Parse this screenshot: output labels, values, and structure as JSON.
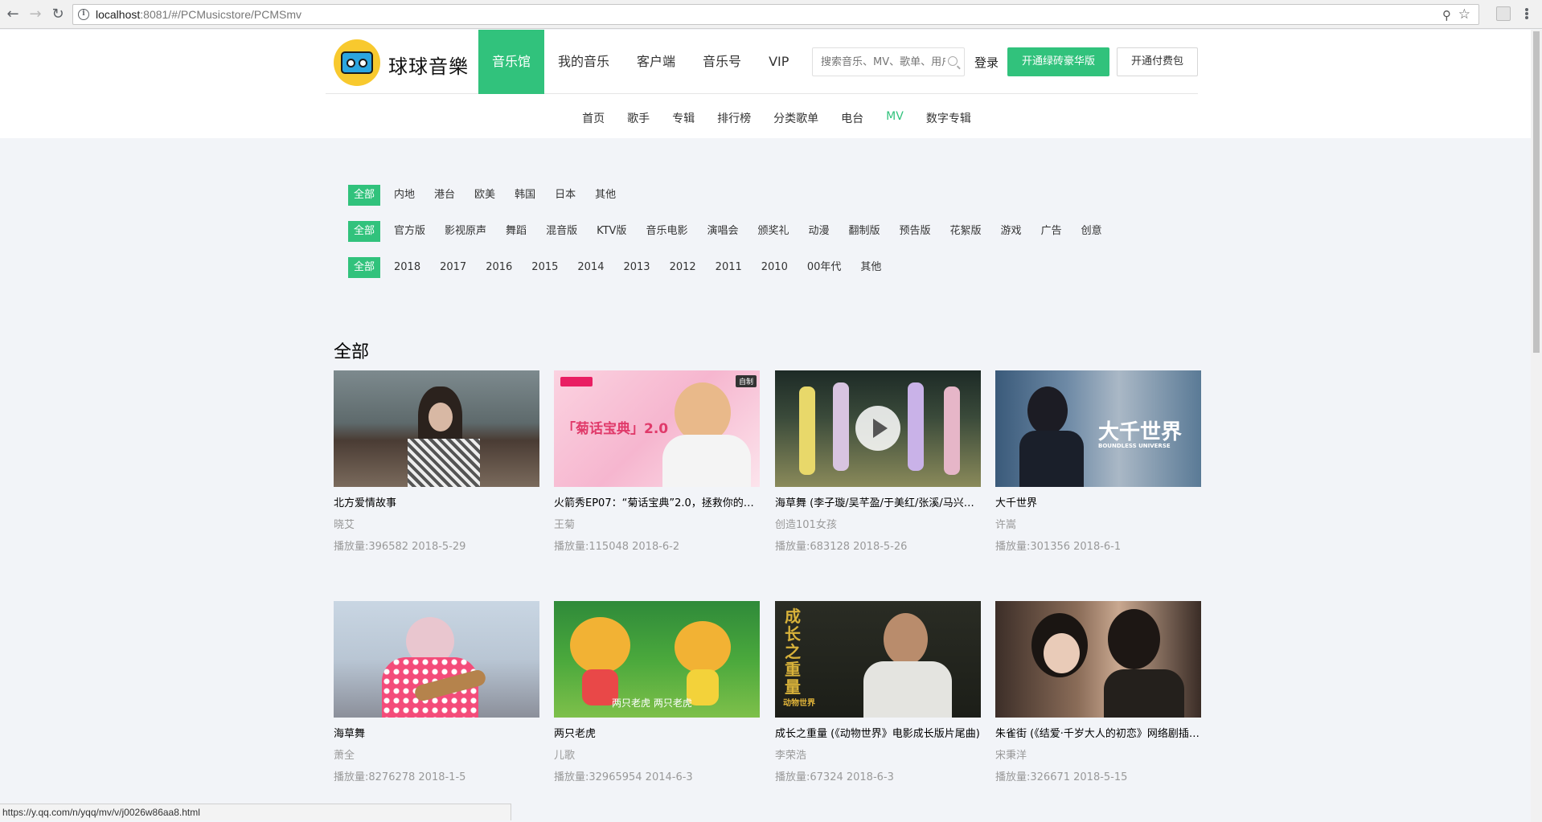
{
  "browser": {
    "url_host": "localhost",
    "url_rest": ":8081/#/PCMusicstore/PCMSmv",
    "status_url": "https://y.qq.com/n/yqq/mv/v/j0026w86aa8.html"
  },
  "header": {
    "brand": "球球音樂",
    "nav": [
      "音乐馆",
      "我的音乐",
      "客户端",
      "音乐号",
      "VIP"
    ],
    "active_nav": "音乐馆",
    "search_placeholder": "搜索音乐、MV、歌单、用户",
    "login": "登录",
    "green_button": "开通绿砖豪华版",
    "outline_button": "开通付费包",
    "sub_nav": [
      "首页",
      "歌手",
      "专辑",
      "排行榜",
      "分类歌单",
      "电台",
      "MV",
      "数字专辑"
    ],
    "active_sub_nav": "MV"
  },
  "filters": {
    "area": [
      "全部",
      "内地",
      "港台",
      "欧美",
      "韩国",
      "日本",
      "其他"
    ],
    "version": [
      "全部",
      "官方版",
      "影视原声",
      "舞蹈",
      "混音版",
      "KTV版",
      "音乐电影",
      "演唱会",
      "颁奖礼",
      "动漫",
      "翻制版",
      "预告版",
      "花絮版",
      "游戏",
      "广告",
      "创意"
    ],
    "year": [
      "全部",
      "2018",
      "2017",
      "2016",
      "2015",
      "2014",
      "2013",
      "2012",
      "2011",
      "2010",
      "00年代",
      "其他"
    ]
  },
  "section_title": "全部",
  "mvs": [
    {
      "title": "北方爱情故事",
      "artist": "晓艾",
      "stats": "播放量:396582 2018-5-29",
      "overlay": ""
    },
    {
      "title": "火箭秀EP07：“菊话宝典”2.0，拯救你的…",
      "artist": "王菊",
      "stats": "播放量:115048 2018-6-2",
      "overlay": "「菊话宝典」2.0",
      "badge": "自制"
    },
    {
      "title": "海草舞 (李子璇/吴芊盈/于美红/张溪/马兴钰…",
      "artist": "创造101女孩",
      "stats": "播放量:683128 2018-5-26",
      "overlay": ""
    },
    {
      "title": "大千世界",
      "artist": "许嵩",
      "stats": "播放量:301356 2018-6-1",
      "overlay": "大千世界",
      "overlay_sub": "BOUNDLESS UNIVERSE"
    },
    {
      "title": "海草舞",
      "artist": "萧全",
      "stats": "播放量:8276278 2018-1-5",
      "overlay": ""
    },
    {
      "title": "两只老虎",
      "artist": "儿歌",
      "stats": "播放量:32965954 2014-6-3",
      "overlay": "两只老虎 两只老虎"
    },
    {
      "title": "成长之重量 (《动物世界》电影成长版片尾曲)",
      "artist": "李荣浩",
      "stats": "播放量:67324 2018-6-3",
      "overlay": "成长之重量",
      "overlay_sub": "动物世界"
    },
    {
      "title": "朱雀街 (《结爱·千岁大人的初恋》网络剧插曲)",
      "artist": "宋秉洋",
      "stats": "播放量:326671 2018-5-15",
      "overlay": ""
    }
  ]
}
